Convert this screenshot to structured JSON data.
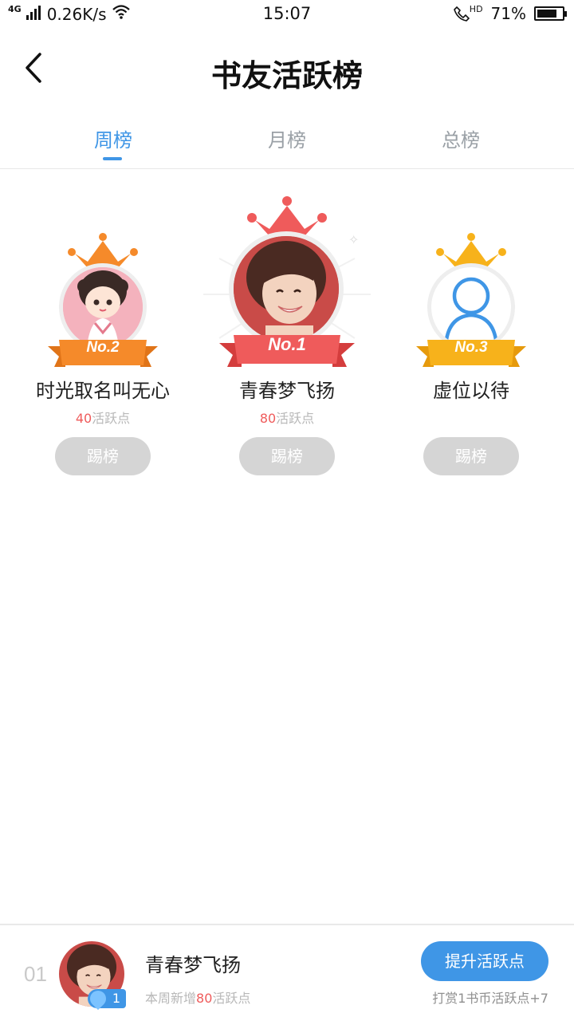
{
  "status_bar": {
    "network": "4G",
    "speed": "0.26K/s",
    "time": "15:07",
    "hd_label": "HD",
    "battery_text": "71%",
    "battery_level": 0.71
  },
  "header": {
    "title": "书友活跃榜"
  },
  "tabs": [
    {
      "label": "周榜",
      "active": true
    },
    {
      "label": "月榜",
      "active": false
    },
    {
      "label": "总榜",
      "active": false
    }
  ],
  "podium": {
    "first": {
      "rank_label": "No.1",
      "name": "青春梦飞扬",
      "points": "80",
      "points_suffix": "活跃点",
      "button": "踢榜"
    },
    "second": {
      "rank_label": "No.2",
      "name": "时光取名叫无心",
      "points": "40",
      "points_suffix": "活跃点",
      "button": "踢榜"
    },
    "third": {
      "rank_label": "No.3",
      "name": "虚位以待",
      "button": "踢榜"
    }
  },
  "colors": {
    "accent": "#3f96e6",
    "gold": "#f7b21b",
    "orange": "#f58a2a",
    "red": "#ef5b5b",
    "button_gray": "#d5d5d5"
  },
  "bottom_bar": {
    "my_rank": "01",
    "badge_level": "1",
    "name": "青春梦飞扬",
    "points_prefix": "本周新增",
    "points": "80",
    "points_suffix": "活跃点",
    "boost_button": "提升活跃点",
    "hint": "打赏1书币活跃点+7"
  }
}
